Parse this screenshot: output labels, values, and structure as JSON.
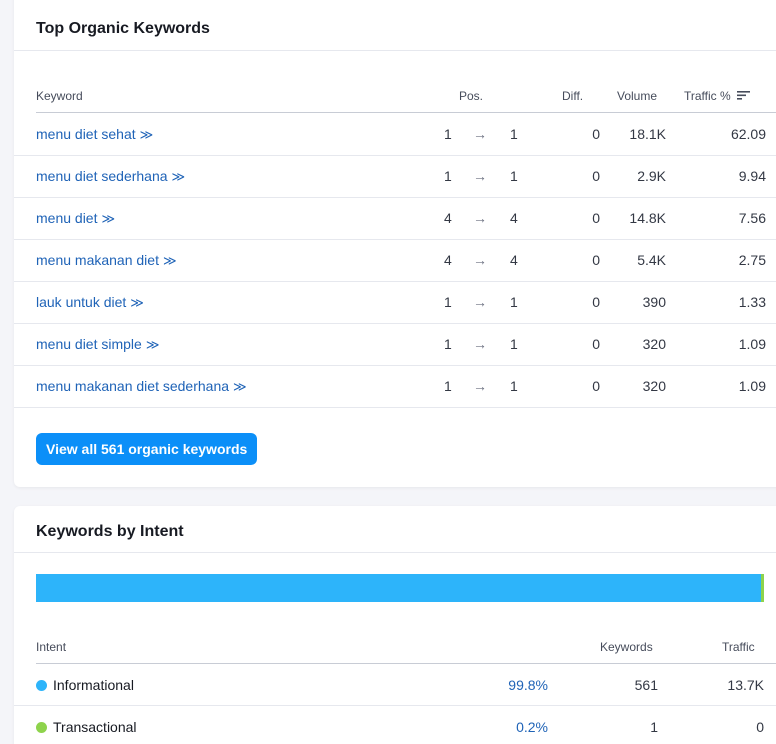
{
  "top_keywords": {
    "title": "Top Organic Keywords",
    "columns": {
      "keyword": "Keyword",
      "pos": "Pos.",
      "diff": "Diff.",
      "volume": "Volume",
      "traffic": "Traffic %"
    },
    "rows": [
      {
        "keyword": "menu diet sehat",
        "pos_from": "1",
        "pos_to": "1",
        "diff": "0",
        "volume": "18.1K",
        "traffic": "62.09"
      },
      {
        "keyword": "menu diet sederhana",
        "pos_from": "1",
        "pos_to": "1",
        "diff": "0",
        "volume": "2.9K",
        "traffic": "9.94"
      },
      {
        "keyword": "menu diet",
        "pos_from": "4",
        "pos_to": "4",
        "diff": "0",
        "volume": "14.8K",
        "traffic": "7.56"
      },
      {
        "keyword": "menu makanan diet",
        "pos_from": "4",
        "pos_to": "4",
        "diff": "0",
        "volume": "5.4K",
        "traffic": "2.75"
      },
      {
        "keyword": "lauk untuk diet",
        "pos_from": "1",
        "pos_to": "1",
        "diff": "0",
        "volume": "390",
        "traffic": "1.33"
      },
      {
        "keyword": "menu diet simple",
        "pos_from": "1",
        "pos_to": "1",
        "diff": "0",
        "volume": "320",
        "traffic": "1.09"
      },
      {
        "keyword": "menu makanan diet sederhana",
        "pos_from": "1",
        "pos_to": "1",
        "diff": "0",
        "volume": "320",
        "traffic": "1.09"
      }
    ],
    "view_all_label": "View all 561 organic keywords",
    "chevron_glyph": "≫",
    "arrow_glyph": "→"
  },
  "intent": {
    "title": "Keywords by Intent",
    "columns": {
      "intent": "Intent",
      "keywords": "Keywords",
      "traffic": "Traffic"
    },
    "rows": [
      {
        "name": "Informational",
        "color": "#2db4fa",
        "percent": "99.8%",
        "keywords": "561",
        "traffic": "13.7K"
      },
      {
        "name": "Transactional",
        "color": "#8ed34c",
        "percent": "0.2%",
        "keywords": "1",
        "traffic": "0"
      }
    ],
    "bar": {
      "informational_share": 0.998,
      "transactional_share": 0.002
    }
  }
}
